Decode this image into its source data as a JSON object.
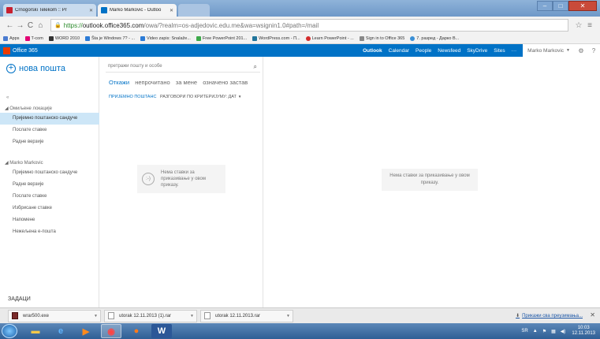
{
  "browser": {
    "tabs": [
      {
        "label": "Crnogorski Telekom :: Pr",
        "color": "#c8202f"
      },
      {
        "label": "Marko Markovic - Outloo",
        "color": "#0072c6"
      },
      {
        "label": "",
        "color": "#aac4e2"
      }
    ],
    "url_scheme": "https://",
    "url_host": "outlook.office365.com",
    "url_path": "/owa/?realm=os-adjedovic.edu.me&wa=wsignin1.0#path=/mail",
    "bookmarks": [
      {
        "label": "Apps",
        "color": "#4a7bd0"
      },
      {
        "label": "T-com",
        "color": "#e20074"
      },
      {
        "label": "WORD 2010",
        "color": "#333333"
      },
      {
        "label": "Šta je Windows 7? - ...",
        "color": "#2c7bd6"
      },
      {
        "label": "Video zapis: Snalaže...",
        "color": "#2c7bd6"
      },
      {
        "label": "Free PowerPoint 201...",
        "color": "#3da94a"
      },
      {
        "label": "WordPress.com - П...",
        "color": "#21759b"
      },
      {
        "label": "Learn PowerPoint - ...",
        "color": "#d42c2c"
      },
      {
        "label": "Sign in to Office 365",
        "color": "#888888"
      },
      {
        "label": "7. разред - Дарко В...",
        "color": "#3a8fd6"
      }
    ]
  },
  "o365": {
    "brand": "Office 365",
    "nav": [
      "Outlook",
      "Calendar",
      "People",
      "Newsfeed",
      "SkyDrive",
      "Sites",
      "···"
    ],
    "user": "Marko Markovic"
  },
  "left": {
    "new_mail": "нова пошта",
    "collapse": "«",
    "favorites_header": "◢ Омиљене локације",
    "favorites": [
      "Пријемно поштанско сандуче",
      "Послате ставке",
      "Радне верзије"
    ],
    "account_header": "◢ Marko Markovic",
    "folders": [
      "Пријемно поштанско сандуче",
      "Радне верзије",
      "Послате ставке",
      "Избрисане ставке",
      "Напомене",
      "Нежељена е-пошта"
    ],
    "tasks": "ЗАДАЦИ"
  },
  "mid": {
    "search_placeholder": "претражи пошту и особе",
    "filters": [
      "Откажи",
      "непрочитано",
      "за мене",
      "означено застав"
    ],
    "crumb_folder": "ПРИЈЕМНО ПОШТАНС",
    "crumb_sort": "РАЗГОВОРИ ПО КРИТЕРИЈУМУ: ДАТ",
    "empty_face": ":-)",
    "empty_msg": "Нема ставки за приказивање у овом приказу."
  },
  "reading": {
    "empty_msg": "Нема ставки за приказивање у овом приказу."
  },
  "downloads": {
    "items": [
      "wrar500.exe",
      "utorak 12.11.2013 (1).rar",
      "utorak 12.11.2013.rar"
    ],
    "show_all": "Прикажи сва преузимања..."
  },
  "taskbar": {
    "lang": "SR",
    "time": "10:03",
    "date": "12.11.2013"
  }
}
